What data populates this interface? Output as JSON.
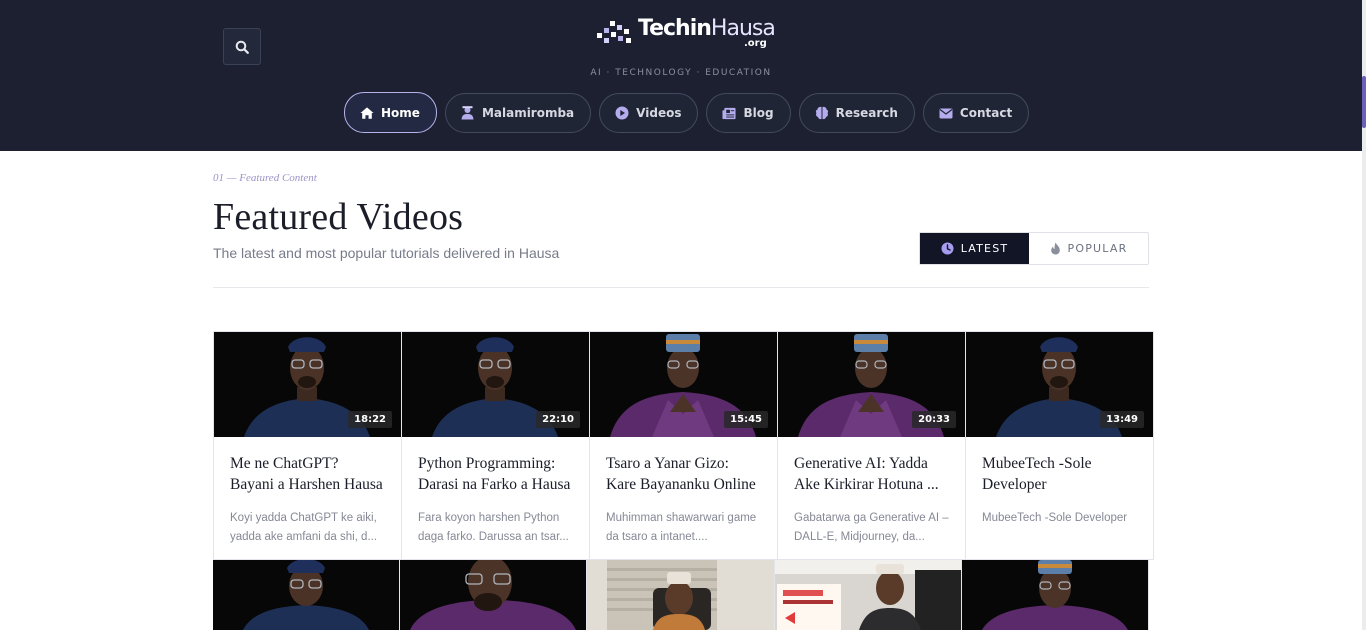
{
  "header": {
    "logo": {
      "brand_a": "Techin",
      "brand_b": "Hausa",
      "suffix": ".org"
    },
    "tagline": "AI · TECHNOLOGY · EDUCATION",
    "search_icon": "search-icon",
    "nav": [
      {
        "label": "Home",
        "icon": "home-icon",
        "active": true
      },
      {
        "label": "Malamiromba",
        "icon": "teacher-icon"
      },
      {
        "label": "Videos",
        "icon": "play-icon"
      },
      {
        "label": "Blog",
        "icon": "newspaper-icon"
      },
      {
        "label": "Research",
        "icon": "brain-icon"
      },
      {
        "label": "Contact",
        "icon": "envelope-icon"
      }
    ]
  },
  "section": {
    "eyebrow": "01 — Featured Content",
    "title": "Featured Videos",
    "subtitle": "The latest and most popular tutorials delivered in Hausa",
    "toggle": {
      "latest": "LATEST",
      "popular": "POPULAR"
    }
  },
  "videos": [
    {
      "title": "Me ne ChatGPT? Bayani a Harshen Hausa",
      "desc": "Koyi yadda ChatGPT ke aiki, yadda ake amfani da shi, d...",
      "duration": "18:22"
    },
    {
      "title": "Python Programming: Darasi na Farko a Hausa",
      "desc": "Fara koyon harshen Python daga farko. Darussa an tsar...",
      "duration": "22:10"
    },
    {
      "title": "Tsaro a Yanar Gizo: Kare Bayananku Online",
      "desc": "Muhimman shawarwari game da tsaro a intanet....",
      "duration": "15:45"
    },
    {
      "title": "Generative AI: Yadda Ake Kirkirar Hotuna ...",
      "desc": "Gabatarwa ga Generative AI – DALL-E, Midjourney, da...",
      "duration": "20:33"
    },
    {
      "title": "MubeeTech -Sole Developer",
      "desc": "MubeeTech -Sole Developer",
      "duration": "13:49"
    }
  ],
  "colors": {
    "header_bg": "#1c2030",
    "accent": "#a79cf0",
    "active_seg": "#111526"
  }
}
